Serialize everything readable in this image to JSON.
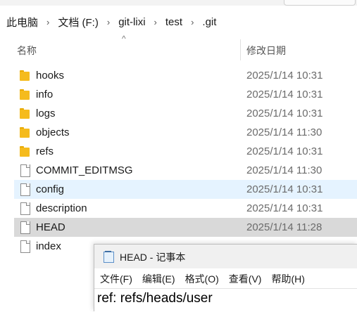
{
  "breadcrumb": [
    "此电脑",
    "文档 (F:)",
    "git-lixi",
    "test",
    ".git"
  ],
  "breadcrumb_separator": "›",
  "sort_arrow": "^",
  "columns": {
    "name": "名称",
    "date": "修改日期"
  },
  "files": [
    {
      "name": "hooks",
      "type": "folder",
      "date": "2025/1/14 10:31"
    },
    {
      "name": "info",
      "type": "folder",
      "date": "2025/1/14 10:31"
    },
    {
      "name": "logs",
      "type": "folder",
      "date": "2025/1/14 10:31"
    },
    {
      "name": "objects",
      "type": "folder",
      "date": "2025/1/14 11:30"
    },
    {
      "name": "refs",
      "type": "folder",
      "date": "2025/1/14 10:31"
    },
    {
      "name": "COMMIT_EDITMSG",
      "type": "file",
      "date": "2025/1/14 11:30"
    },
    {
      "name": "config",
      "type": "file",
      "date": "2025/1/14 10:31",
      "state": "hover"
    },
    {
      "name": "description",
      "type": "file",
      "date": "2025/1/14 10:31"
    },
    {
      "name": "HEAD",
      "type": "file",
      "date": "2025/1/14 11:28",
      "state": "selected"
    },
    {
      "name": "index",
      "type": "file",
      "date": ""
    }
  ],
  "notepad": {
    "title": "HEAD - 记事本",
    "menu": [
      "文件(F)",
      "编辑(E)",
      "格式(O)",
      "查看(V)",
      "帮助(H)"
    ],
    "content": "ref: refs/heads/user"
  },
  "colors": {
    "hover": "#e5f3ff",
    "selected": "#d9d9d9",
    "folder": "#f5bb1d"
  }
}
